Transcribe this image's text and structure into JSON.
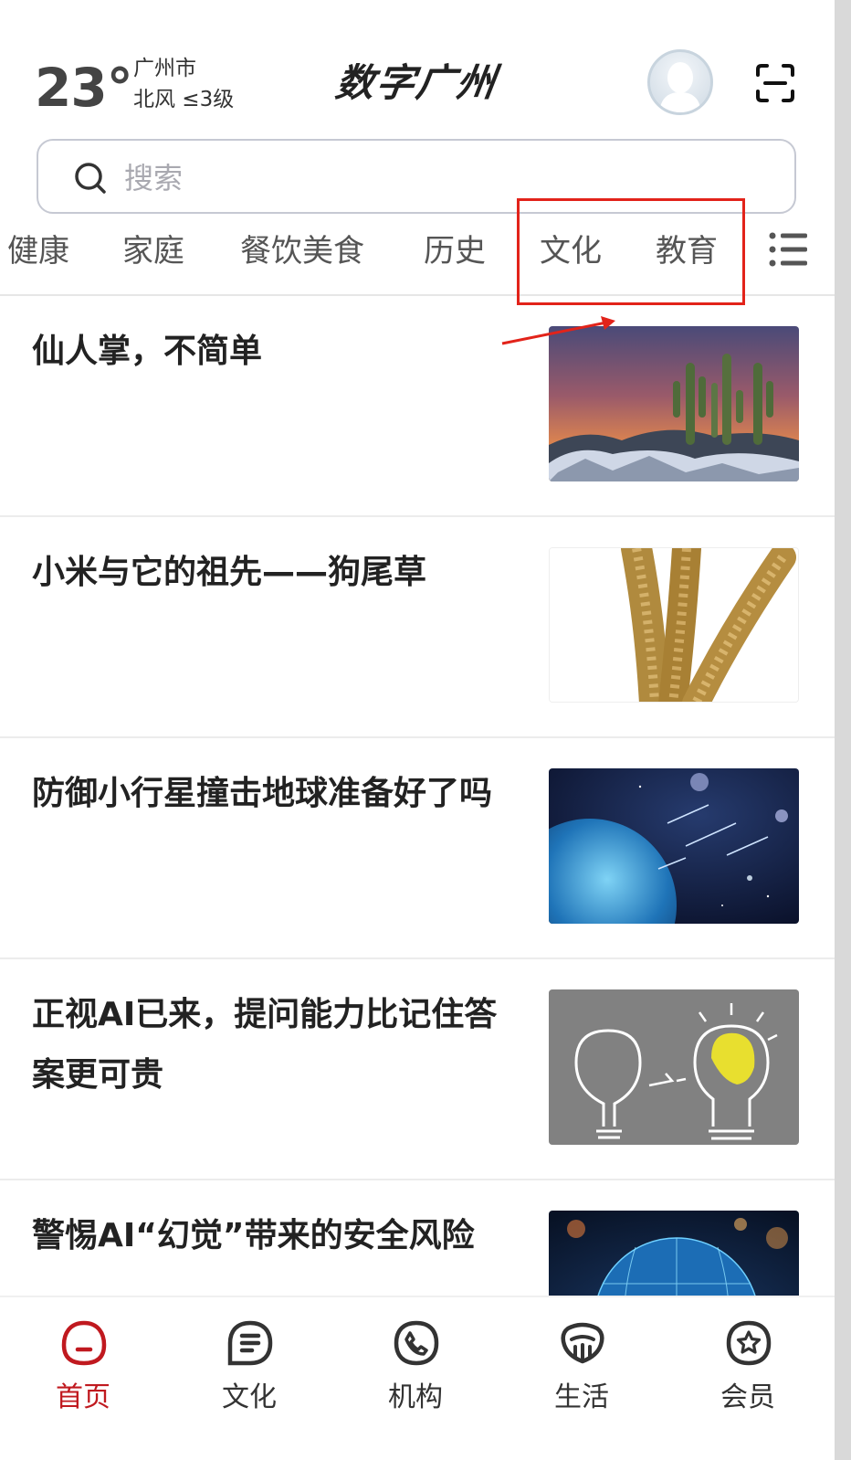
{
  "header": {
    "temperature": "23°",
    "city": "广州市",
    "wind": "北风 ≤3级",
    "app_title": "数字广州"
  },
  "search": {
    "placeholder": "搜索"
  },
  "tabs": [
    {
      "label": "健康"
    },
    {
      "label": "家庭"
    },
    {
      "label": "餐饮美食"
    },
    {
      "label": "历史"
    },
    {
      "label": "文化"
    },
    {
      "label": "教育"
    }
  ],
  "articles": [
    {
      "title": "仙人掌，不简单",
      "image": "cactus-sunset-photo"
    },
    {
      "title": "小米与它的祖先——狗尾草",
      "image": "millet-photo"
    },
    {
      "title": "防御小行星撞击地球准备好了吗",
      "image": "earth-space-photo"
    },
    {
      "title": "正视AI已来，提问能力比记住答案更可贵",
      "image": "lightbulb-chalkboard-photo"
    },
    {
      "title": "警惕AI“幻觉”带来的安全风险",
      "image": "digital-globe-photo"
    }
  ],
  "bottom_nav": [
    {
      "label": "首页",
      "icon": "home-icon",
      "active": true
    },
    {
      "label": "文化",
      "icon": "culture-icon",
      "active": false
    },
    {
      "label": "机构",
      "icon": "phone-icon",
      "active": false
    },
    {
      "label": "生活",
      "icon": "life-icon",
      "active": false
    },
    {
      "label": "会员",
      "icon": "member-icon",
      "active": false
    }
  ],
  "colors": {
    "accent": "#c0191f",
    "annotation": "#e2231a"
  }
}
